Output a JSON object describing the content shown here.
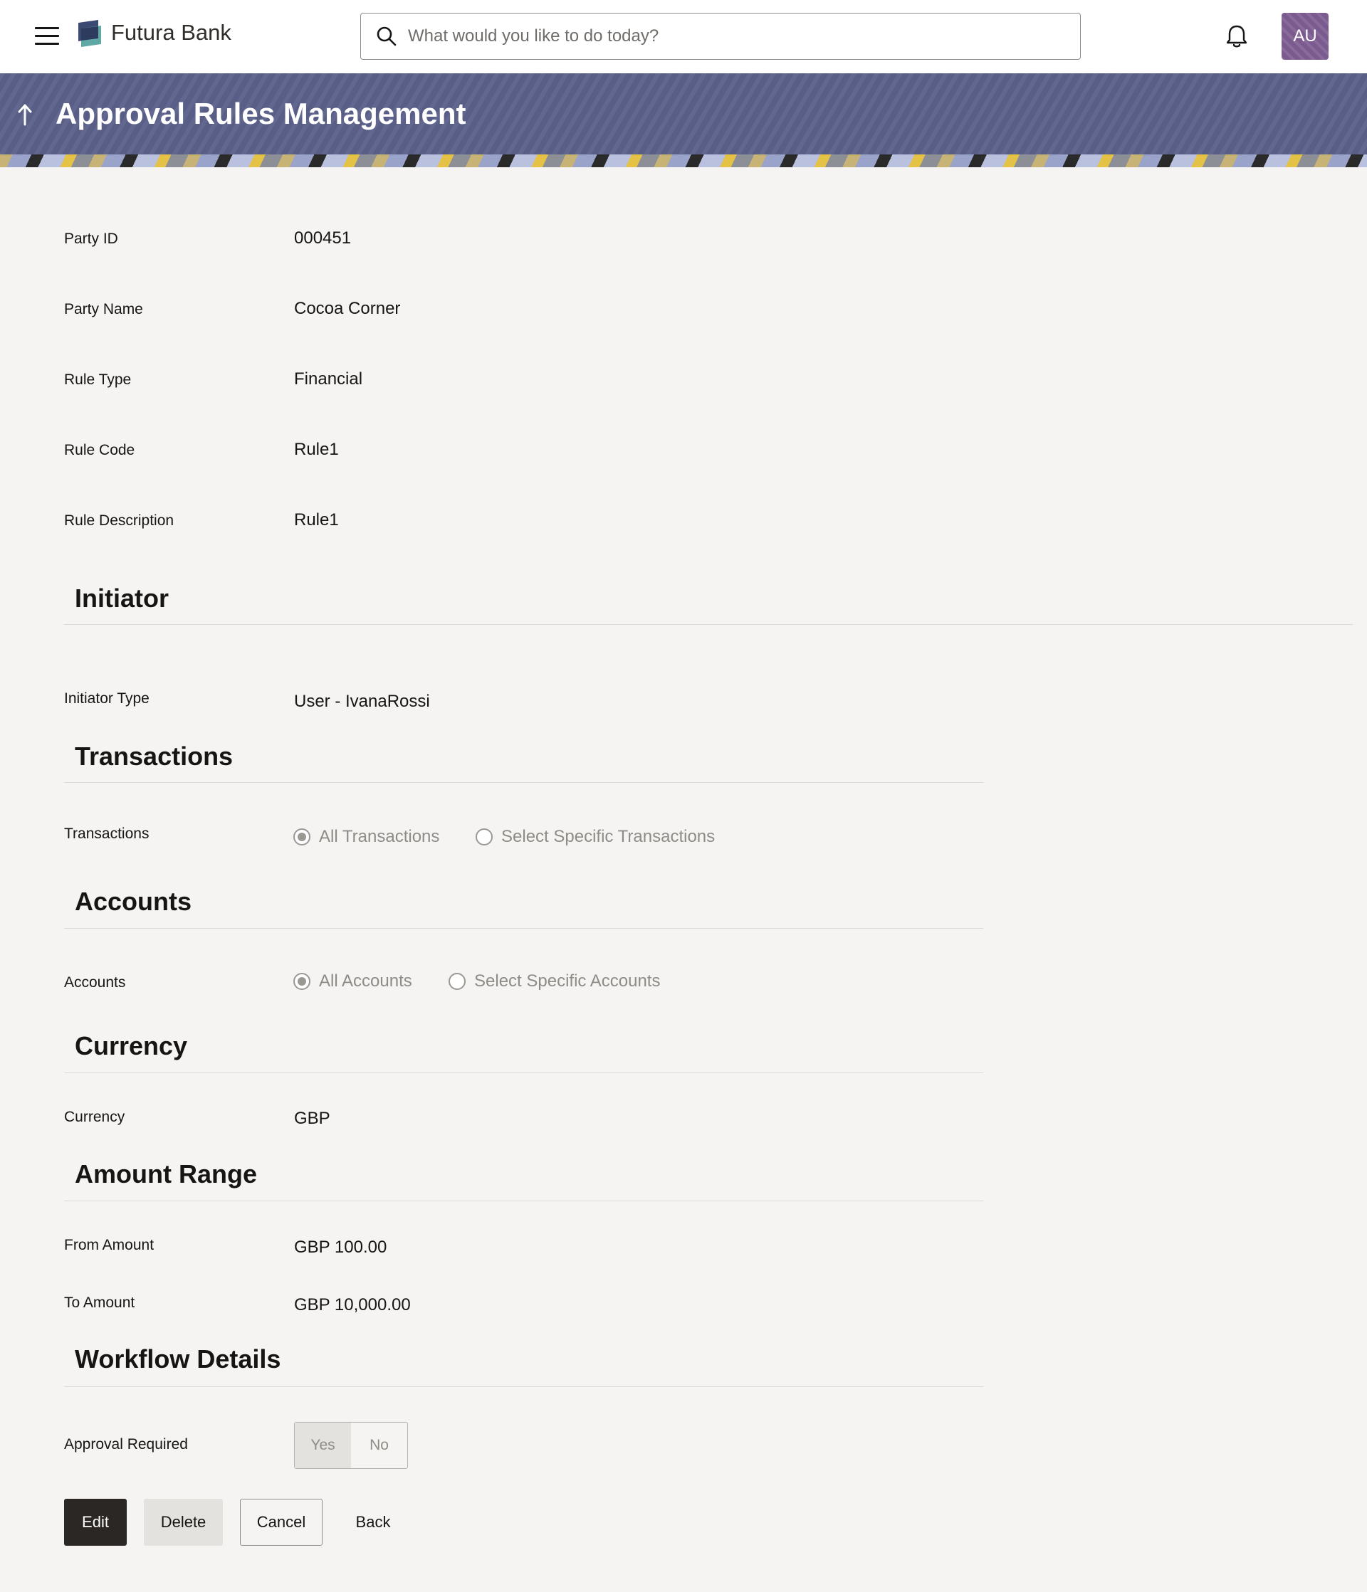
{
  "header": {
    "brand": "Futura Bank",
    "search_placeholder": "What would you like to do today?",
    "avatar_initials": "AU"
  },
  "page": {
    "title": "Approval Rules Management"
  },
  "details": [
    {
      "label": "Party ID",
      "value": "000451"
    },
    {
      "label": "Party Name",
      "value": "Cocoa Corner"
    },
    {
      "label": "Rule Type",
      "value": "Financial"
    },
    {
      "label": "Rule Code",
      "value": "Rule1"
    },
    {
      "label": "Rule Description",
      "value": "Rule1"
    }
  ],
  "initiator": {
    "heading": "Initiator",
    "type_label": "Initiator Type",
    "type_value": "User - IvanaRossi"
  },
  "transactions": {
    "heading": "Transactions",
    "label": "Transactions",
    "options": [
      "All Transactions",
      "Select Specific Transactions"
    ],
    "selected": "All Transactions"
  },
  "accounts": {
    "heading": "Accounts",
    "label": "Accounts",
    "options": [
      "All Accounts",
      "Select Specific Accounts"
    ],
    "selected": "All Accounts"
  },
  "currency": {
    "heading": "Currency",
    "label": "Currency",
    "value": "GBP"
  },
  "amount_range": {
    "heading": "Amount Range",
    "from_label": "From Amount",
    "from_value": "GBP 100.00",
    "to_label": "To Amount",
    "to_value": "GBP 10,000.00"
  },
  "workflow": {
    "heading": "Workflow Details",
    "approval_label": "Approval Required",
    "yes": "Yes",
    "no": "No",
    "selected": "Yes"
  },
  "actions": {
    "edit": "Edit",
    "delete": "Delete",
    "cancel": "Cancel",
    "back": "Back"
  }
}
